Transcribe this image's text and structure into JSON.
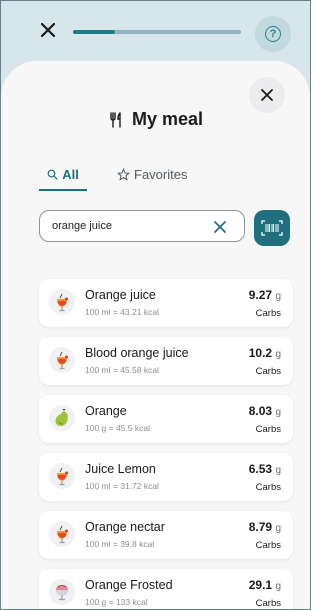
{
  "header": {
    "progress_percent": 25
  },
  "sheet": {
    "title": "My meal",
    "tabs": [
      {
        "label": "All",
        "icon": "search-icon",
        "active": true
      },
      {
        "label": "Favorites",
        "icon": "star-icon",
        "active": false
      }
    ],
    "search": {
      "value": "orange juice"
    }
  },
  "items": [
    {
      "name": "Orange juice",
      "desc": "100 ml = 43.21 kcal",
      "amount": "9.27",
      "unit": "g",
      "nutrient": "Carbs",
      "icon": "cocktail-icon"
    },
    {
      "name": "Blood orange juice",
      "desc": "100 ml = 45.58 kcal",
      "amount": "10.2",
      "unit": "g",
      "nutrient": "Carbs",
      "icon": "cocktail-icon"
    },
    {
      "name": "Orange",
      "desc": "100 g = 45.5 kcal",
      "amount": "8.03",
      "unit": "g",
      "nutrient": "Carbs",
      "icon": "pear-icon"
    },
    {
      "name": "Juice Lemon",
      "desc": "100 ml = 31.72 kcal",
      "amount": "6.53",
      "unit": "g",
      "nutrient": "Carbs",
      "icon": "cocktail-icon"
    },
    {
      "name": "Orange nectar",
      "desc": "100 ml = 39.8 kcal",
      "amount": "8.79",
      "unit": "g",
      "nutrient": "Carbs",
      "icon": "cocktail-icon"
    },
    {
      "name": "Orange Frosted",
      "desc": "100 g = 133 kcal",
      "amount": "29.1",
      "unit": "g",
      "nutrient": "Carbs",
      "icon": "ice-cream-icon"
    }
  ],
  "colors": {
    "accent": "#1b6f80",
    "header_bg": "#d7e6ea",
    "sheet_bg": "#f7f7f8"
  }
}
